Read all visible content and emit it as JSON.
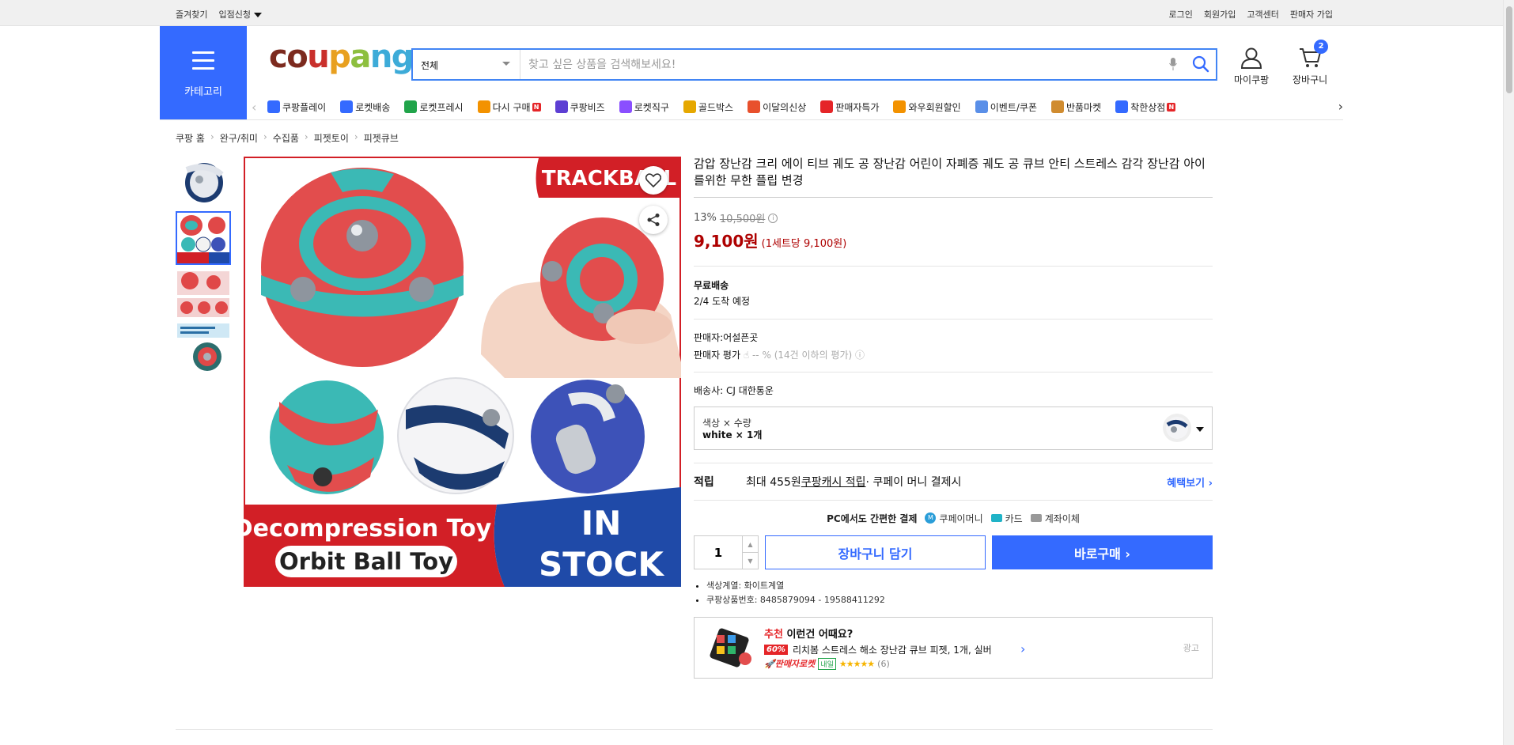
{
  "topbar": {
    "left": [
      "즐겨찾기",
      "입점신청"
    ],
    "right": [
      "로그인",
      "회원가입",
      "고객센터",
      "판매자 가입"
    ]
  },
  "header": {
    "category_label": "카테고리",
    "logo": "coupang",
    "search": {
      "category": "전체",
      "placeholder": "찾고 싶은 상품을 검색해보세요!"
    },
    "mypage_label": "마이쿠팡",
    "cart_label": "장바구니",
    "cart_count": "2"
  },
  "nav": [
    {
      "label": "쿠팡플레이",
      "icon": "play-icon",
      "color": "#346aff"
    },
    {
      "label": "로켓배송",
      "icon": "rocket-icon",
      "color": "#346aff"
    },
    {
      "label": "로켓프레시",
      "icon": "rocket-fresh-icon",
      "color": "#21a44a"
    },
    {
      "label": "다시 구매",
      "icon": "home-icon",
      "color": "#f39200",
      "badge": "N"
    },
    {
      "label": "쿠팡비즈",
      "icon": "biz-icon",
      "color": "#5d3fd3",
      "prefix": "biz"
    },
    {
      "label": "로켓직구",
      "icon": "globe-icon",
      "color": "#8a4fff"
    },
    {
      "label": "골드박스",
      "icon": "gold-box-icon",
      "color": "#e6a800"
    },
    {
      "label": "이달의신상",
      "icon": "bag-icon",
      "color": "#e8502c"
    },
    {
      "label": "판매자특가",
      "icon": "percent-icon",
      "color": "#e52528"
    },
    {
      "label": "와우회원할인",
      "icon": "wow-icon",
      "color": "#f39200"
    },
    {
      "label": "이벤트/쿠폰",
      "icon": "coupon-icon",
      "color": "#5a8fe8"
    },
    {
      "label": "반품마켓",
      "icon": "market-icon",
      "color": "#d08c30"
    },
    {
      "label": "착한상점",
      "icon": "store-icon",
      "color": "#346aff",
      "badge": "N"
    }
  ],
  "breadcrumb": [
    "쿠팡 홈",
    "완구/취미",
    "수집품",
    "피젯토이",
    "피젯큐브"
  ],
  "main_image": {
    "top_right_text": "TRACKBALL",
    "banner_line1": "Decompression Toy",
    "banner_line2": "Orbit Ball Toy",
    "stock_line1": "IN",
    "stock_line2": "STOCK"
  },
  "product": {
    "title": "감압 장난감 크리 에이 티브 궤도 공 장난감 어린이 자폐증 궤도 공 큐브 안티 스트레스 감각 장난감 아이를위한 무한 플립 변경",
    "discount_rate": "13%",
    "original_price": "10,500원",
    "price": "9,100원",
    "unit_price": "(1세트당 9,100원)",
    "shipping_label": "무료배송",
    "arrival": "2/4 도착 예정",
    "seller": "판매자:어설픈곳",
    "seller_rating_label": "판매자 평가",
    "seller_rating_value": "-- %",
    "seller_rating_note": "(14건 이하의 평가)",
    "carrier": "배송사:  CJ 대한통운",
    "option_label": "색상 × 수량",
    "option_value": "white × 1개",
    "points_key": "적립",
    "points_text1": "최대 455원 ",
    "points_link": "쿠팡캐시 적립",
    "points_text2": " · 쿠페이 머니 결제시",
    "points_more": "혜택보기 ›",
    "pay_title": "PC에서도 간편한 결제",
    "pay_methods": [
      "쿠페이머니",
      "카드",
      "계좌이체"
    ],
    "qty": "1",
    "cart_button": "장바구니 담기",
    "buy_button": "바로구매 ›",
    "specs": [
      "색상계열: 화이트계열",
      "쿠팡상품번호: 8485879094 - 19588411292"
    ]
  },
  "recommendation": {
    "heading_red": "추천",
    "heading_rest": " 이런건 어때요?",
    "discount": "60%",
    "name": "리치봄 스트레스 해소 장난감 큐브 피젯, 1개, 실버",
    "rocket": "🚀판매자로켓",
    "tomorrow": "내일",
    "stars": "★★★★★",
    "review_count": "(6)",
    "ad_label": "광고"
  },
  "colors": {
    "accent": "#346aff",
    "price_red": "#ae0000"
  }
}
